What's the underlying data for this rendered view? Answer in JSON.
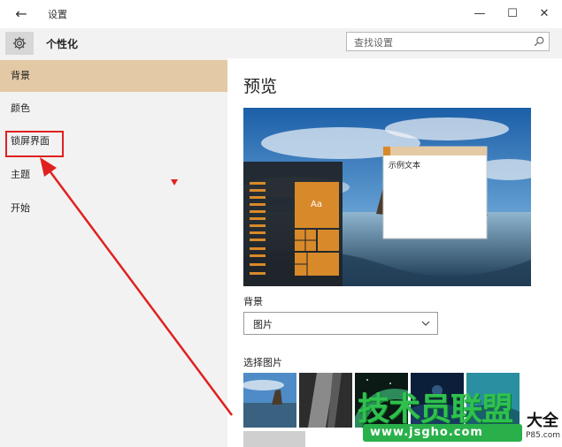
{
  "window": {
    "title": "设置",
    "back_glyph": "←",
    "minimize_glyph": "—",
    "maximize_glyph": "☐",
    "close_glyph": "✕"
  },
  "header": {
    "section_title": "个性化",
    "search_placeholder": "查找设置",
    "icons": {
      "settings": "gear-icon",
      "search": "search-icon"
    }
  },
  "sidebar": {
    "items": [
      {
        "label": "背景",
        "selected": true
      },
      {
        "label": "颜色",
        "selected": false
      },
      {
        "label": "锁屏界面",
        "selected": false
      },
      {
        "label": "主题",
        "selected": false
      },
      {
        "label": "开始",
        "selected": false
      }
    ]
  },
  "main": {
    "title": "预览",
    "preview": {
      "sample_text": "示例文本",
      "tile_label": "Aa"
    },
    "background_label": "背景",
    "background_value": "图片",
    "choose_picture_label": "选择图片"
  },
  "watermark": {
    "text": "技术员联盟",
    "suffix": "大全",
    "url": "www.jsgho.com",
    "url2": "P85.com"
  },
  "colors": {
    "accent": "#e3c9a4",
    "sidebar_bg": "#f2f2f2",
    "tile_orange": "#d88a2a",
    "annotation_red": "#e02020"
  }
}
